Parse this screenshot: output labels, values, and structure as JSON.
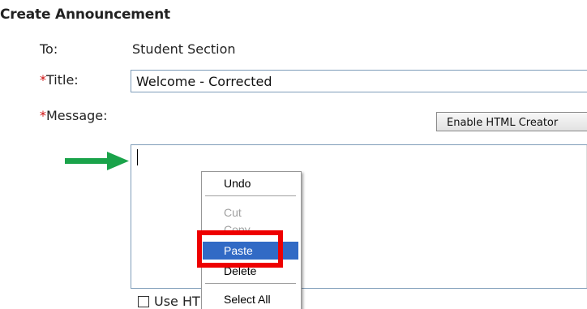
{
  "page_title": "Create Announcement",
  "form": {
    "to_label": "To:",
    "to_value": "Student Section",
    "title_required_mark": "*",
    "title_label": "Title:",
    "title_value": "Welcome - Corrected",
    "message_required_mark": "*",
    "message_label": "Message:",
    "message_value": "",
    "html_creator_button": "Enable HTML Creator",
    "use_html_label": "Use HTML",
    "use_html_checked": false
  },
  "context_menu": {
    "items": [
      {
        "label": "Undo",
        "enabled": true
      },
      {
        "label": "Cut",
        "enabled": false
      },
      {
        "label": "Copy",
        "enabled": false
      },
      {
        "label": "Paste",
        "enabled": true,
        "highlighted": true
      },
      {
        "label": "Delete",
        "enabled": true
      },
      {
        "label": "Select All",
        "enabled": true
      }
    ]
  },
  "annotations": {
    "arrow_color": "#1aa34a",
    "highlight_box_color": "#ee0000"
  },
  "colors": {
    "required_mark": "#d01010",
    "menu_highlight": "#316ac5",
    "input_border": "#7f9db9"
  }
}
